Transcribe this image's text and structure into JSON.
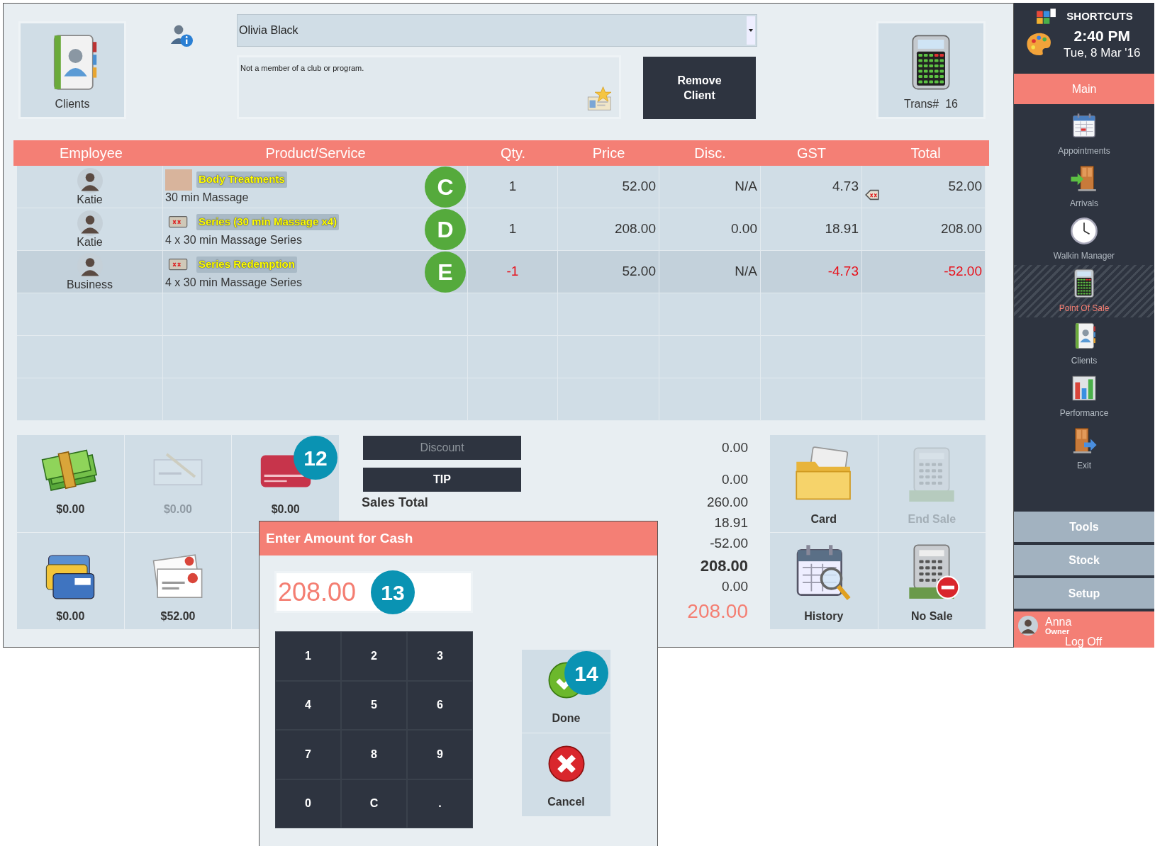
{
  "client_tile": {
    "label": "Clients"
  },
  "client_select": {
    "value": "Olivia Black"
  },
  "membership_note": "Not a member of a club or program.",
  "remove_client_button": "Remove Client",
  "transaction_tile": {
    "label": "Trans#  16"
  },
  "table": {
    "columns": [
      "Employee",
      "Product/Service",
      "Qty.",
      "Price",
      "Disc.",
      "GST",
      "Total"
    ],
    "rows": [
      {
        "employee": "Katie",
        "category": "Body Treatments",
        "item": "30 min Massage",
        "marker": "C",
        "qty": "1",
        "price": "52.00",
        "disc": "N/A",
        "gst": "4.73",
        "total": "52.00",
        "negative": false,
        "selected": false,
        "gst_tag": true
      },
      {
        "employee": "Katie",
        "category": "Series (30 min Massage x4)",
        "item": "4 x 30 min Massage Series",
        "marker": "D",
        "qty": "1",
        "price": "208.00",
        "disc": "0.00",
        "gst": "18.91",
        "total": "208.00",
        "negative": false,
        "selected": false,
        "gst_tag": false
      },
      {
        "employee": "Business",
        "category": "Series Redemption",
        "item": "4 x 30 min Massage Series",
        "marker": "E",
        "qty": "-1",
        "price": "52.00",
        "disc": "N/A",
        "gst": "-4.73",
        "total": "-52.00",
        "negative": true,
        "selected": true,
        "gst_tag": false
      }
    ]
  },
  "payment_tiles": [
    {
      "amount": "$0.00",
      "disabled": false
    },
    {
      "amount": "$0.00",
      "disabled": true
    },
    {
      "amount": "$0.00",
      "disabled": false
    },
    {
      "amount": "$0.00",
      "disabled": false
    },
    {
      "amount": "$52.00",
      "disabled": false
    }
  ],
  "payment_badge": "12",
  "totals": [
    {
      "kind": "button",
      "button": "Discount",
      "disabled": true,
      "value": "0.00",
      "bold": false,
      "accent": false
    },
    {
      "kind": "button",
      "button": "TIP",
      "disabled": false,
      "value": "0.00",
      "bold": false,
      "accent": false
    },
    {
      "kind": "line",
      "label": "Sales Total",
      "value": "260.00",
      "bold": false,
      "accent": false
    },
    {
      "kind": "line",
      "value": "18.91",
      "bold": false,
      "accent": false
    },
    {
      "kind": "line",
      "value": "-52.00",
      "bold": false,
      "accent": false
    },
    {
      "kind": "line",
      "value": "208.00",
      "bold": true,
      "accent": false
    },
    {
      "kind": "line",
      "value": "0.00",
      "bold": false,
      "accent": false
    },
    {
      "kind": "line",
      "value": "208.00",
      "bold": false,
      "accent": true
    }
  ],
  "action_tiles": [
    {
      "label": "Card",
      "disabled": false
    },
    {
      "label": "End Sale",
      "disabled": true
    },
    {
      "label": "History",
      "disabled": false
    },
    {
      "label": "No Sale",
      "disabled": false
    }
  ],
  "sidebar": {
    "title": "SHORTCUTS",
    "time": "2:40 PM",
    "date": "Tue, 8 Mar '16",
    "tabs": [
      {
        "label": "Main",
        "selected": true
      }
    ],
    "items": [
      {
        "label": "Appointments",
        "selected": false
      },
      {
        "label": "Arrivals",
        "selected": false
      },
      {
        "label": "Walkin Manager",
        "selected": false
      },
      {
        "label": "Point Of Sale",
        "selected": true
      },
      {
        "label": "Clients",
        "selected": false
      },
      {
        "label": "Performance",
        "selected": false
      },
      {
        "label": "Exit",
        "selected": false
      }
    ],
    "buttons": [
      "Tools",
      "Stock",
      "Setup"
    ],
    "user": {
      "name": "Anna",
      "role": "Owner",
      "action": "Log Off"
    }
  },
  "dialog": {
    "title": "Enter Amount for Cash",
    "amount": "208.00",
    "amount_badge": "13",
    "keys": [
      "1",
      "2",
      "3",
      "4",
      "5",
      "6",
      "7",
      "8",
      "9",
      "0",
      "C",
      "."
    ],
    "done": "Done",
    "done_badge": "14",
    "cancel": "Cancel"
  }
}
